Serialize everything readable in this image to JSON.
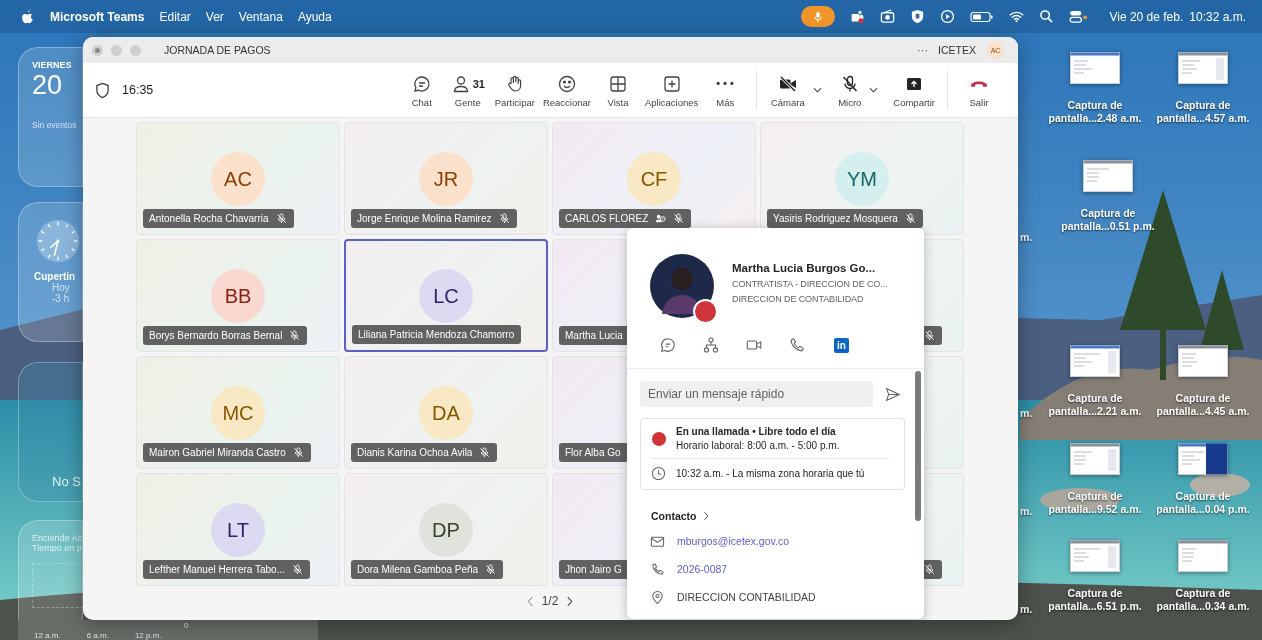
{
  "menu_bar": {
    "app": "Microsoft Teams",
    "menus": [
      "Editar",
      "Ver",
      "Ventana",
      "Ayuda"
    ],
    "date": "Vie 20 de feb.",
    "time": "10:32 a.m."
  },
  "widgets": {
    "calendar": {
      "day_name": "VIERNES",
      "day": "20",
      "events": "Sin eventos"
    },
    "clock": {
      "city": "Cupertin",
      "day": "Hoy",
      "offset": "-3 h"
    },
    "focus": {
      "text": "No S"
    },
    "screen_time": {
      "lines": [
        "Enciende Ac",
        "Tiempo en p"
      ],
      "axis": [
        "12 a.m.",
        "6 a.m.",
        "12 p.m."
      ],
      "value": "0"
    }
  },
  "desktop_files": [
    {
      "line1": "Captura de",
      "line2": "pantalla...2.48 a.m."
    },
    {
      "line1": "Captura de",
      "line2": "pantalla...4.57 a.m."
    },
    {
      "line1": "Captura de",
      "line2": "pantalla...0.51 p.m."
    },
    {
      "line1": "Captura de",
      "line2": "pantalla...2.21 a.m."
    },
    {
      "line1": "Captura de",
      "line2": "pantalla...4.45 a.m."
    },
    {
      "line1": "Captura de",
      "line2": "pantalla...9.52 a.m."
    },
    {
      "line1": "Captura de",
      "line2": "pantalla...0.04 p.m."
    },
    {
      "line1": "Captura de",
      "line2": "pantalla...6.51 p.m."
    },
    {
      "line1": "Captura de",
      "line2": "pantalla...0.34 a.m."
    }
  ],
  "desktop_edge_labels": [
    "m.",
    "m.",
    "m.",
    "m."
  ],
  "window": {
    "title": "JORNADA DE PAGOS",
    "more": "···",
    "org": "ICETEX",
    "user_initials": "AC"
  },
  "toolbar": {
    "timer": "16:35",
    "buttons": [
      {
        "kind": "button",
        "label": "Chat"
      },
      {
        "kind": "button",
        "label": "Gente",
        "count": "31"
      },
      {
        "kind": "button",
        "label": "Participar"
      },
      {
        "kind": "button",
        "label": "Reaccionar"
      },
      {
        "kind": "button",
        "label": "Vista"
      },
      {
        "kind": "button",
        "label": "Aplicaciones"
      },
      {
        "kind": "button",
        "label": "Más"
      },
      {
        "kind": "split",
        "label": "Cámara"
      },
      {
        "kind": "split",
        "label": "Micro"
      },
      {
        "kind": "button",
        "label": "Compartir"
      },
      {
        "kind": "leave",
        "label": "Salir"
      }
    ]
  },
  "tiles": [
    {
      "initials": "AC",
      "color": "#fbe1cb",
      "name": "Antonella Rocha Chavarria",
      "muted": true,
      "status_icon": false,
      "selected": false
    },
    {
      "initials": "JR",
      "color": "#fbe1cb",
      "name": "Jorge Enrique Molina Ramirez",
      "muted": true,
      "status_icon": false,
      "selected": false
    },
    {
      "initials": "CF",
      "color": "#f8e9c4",
      "name": "CARLOS FLOREZ",
      "muted": true,
      "status_icon": true,
      "selected": false
    },
    {
      "initials": "YM",
      "color": "#d5eeee",
      "name": "Yasiris Rodriguez Mosquera",
      "muted": true,
      "status_icon": false,
      "selected": false
    },
    {
      "initials": "BB",
      "color": "#f9d8d2",
      "name": "Borys Bernardo Borras Bernal",
      "muted": true,
      "status_icon": false,
      "selected": false
    },
    {
      "initials": "LC",
      "color": "#dcdaf0",
      "name": "Liliana Patricia Mendoza Chamorro",
      "muted": false,
      "status_icon": false,
      "selected": true
    },
    {
      "name": "Martha Lucia",
      "muted": false,
      "status_icon": false,
      "selected": false
    },
    {
      "muted": true,
      "status_icon": false,
      "selected": false
    },
    {
      "initials": "MC",
      "color": "#f8e9c4",
      "name": "Mairon Gabriel Miranda Castro",
      "muted": true,
      "status_icon": false,
      "selected": false
    },
    {
      "initials": "DA",
      "color": "#f8e9c4",
      "name": "Dianis Karina Ochoa Avila",
      "muted": true,
      "status_icon": false,
      "selected": false
    },
    {
      "name": "Flor Alba Go",
      "muted": false,
      "status_icon": false,
      "selected": false
    },
    {
      "muted": false,
      "status_icon": false,
      "selected": false
    },
    {
      "initials": "LT",
      "color": "#dcdaf0",
      "name": "Lefther Manuel Herrera Tabo...",
      "muted": true,
      "status_icon": false,
      "selected": false
    },
    {
      "initials": "DP",
      "color": "#dfe3dc",
      "name": "Dora Milena Gamboa Peña",
      "muted": true,
      "status_icon": false,
      "selected": false
    },
    {
      "name": "Jhon Jairo G",
      "muted": false,
      "status_icon": false,
      "selected": false
    },
    {
      "muted": true,
      "status_icon": false,
      "selected": false
    }
  ],
  "pager": {
    "text": "1/2"
  },
  "profile": {
    "name": "Martha Lucia Burgos Go...",
    "title": "CONTRATISTA - DIRECCION DE CO...",
    "department": "DIRECCION DE CONTABILIDAD",
    "linkedin": "in",
    "message_placeholder": "Enviar un mensaje rápido",
    "status": "En una llamada • Libre todo el día",
    "hours": "Horario laboral: 8:00 a.m. - 5:00 p.m.",
    "local_time": "10:32 a.m. - La misma zona horaria que tú",
    "contact_heading": "Contacto",
    "contacts": [
      {
        "kind": "email",
        "text": "mburgos@icetex.gov.co"
      },
      {
        "kind": "phone",
        "text": "2026-0087"
      },
      {
        "kind": "location",
        "text": "DIRECCION CONTABILIDAD"
      }
    ]
  }
}
